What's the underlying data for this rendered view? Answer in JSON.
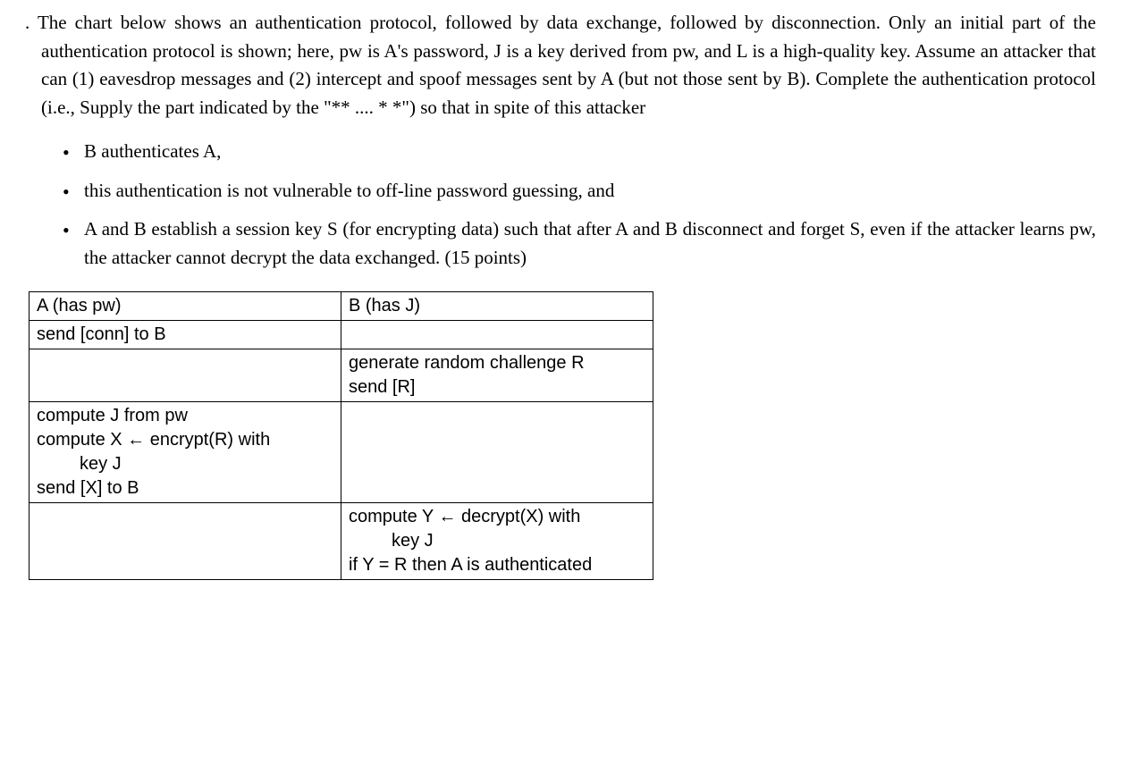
{
  "intro": ". The chart below shows an authentication protocol, followed by data exchange, followed by disconnection. Only an initial part of the authentication protocol is shown; here, pw is A's password, J is a key derived from pw, and L is a high-quality key. Assume an attacker that can (1) eavesdrop messages and (2) intercept and spoof messages sent by A (but not those sent by B). Complete the authentication protocol (i.e., Supply the part indicated by the \"** .... * *\") so that in spite of this attacker",
  "bullets": {
    "b1": "B authenticates A,",
    "b2": "this authentication is not vulnerable to off-line password guessing, and",
    "b3": "A and B establish a session key S (for encrypting data) such that after A and B disconnect and forget S, even if the attacker learns pw, the attacker cannot decrypt the data exchanged. (15 points)"
  },
  "table": {
    "r0": {
      "a": "A (has pw)",
      "b": "B (has J)"
    },
    "r1": {
      "a": "send [conn] to B",
      "b": ""
    },
    "r2": {
      "a": "",
      "b1": "generate random challenge R",
      "b2": "send [R]"
    },
    "r3": {
      "a1": "compute J from pw",
      "a2": "compute X ← encrypt(R) with",
      "a2i": "key J",
      "a3": "send [X] to B",
      "b": ""
    },
    "r4": {
      "a": "",
      "b1": "compute Y ← decrypt(X) with",
      "b1i": "key J",
      "b2": "if Y = R then A is authenticated"
    }
  }
}
